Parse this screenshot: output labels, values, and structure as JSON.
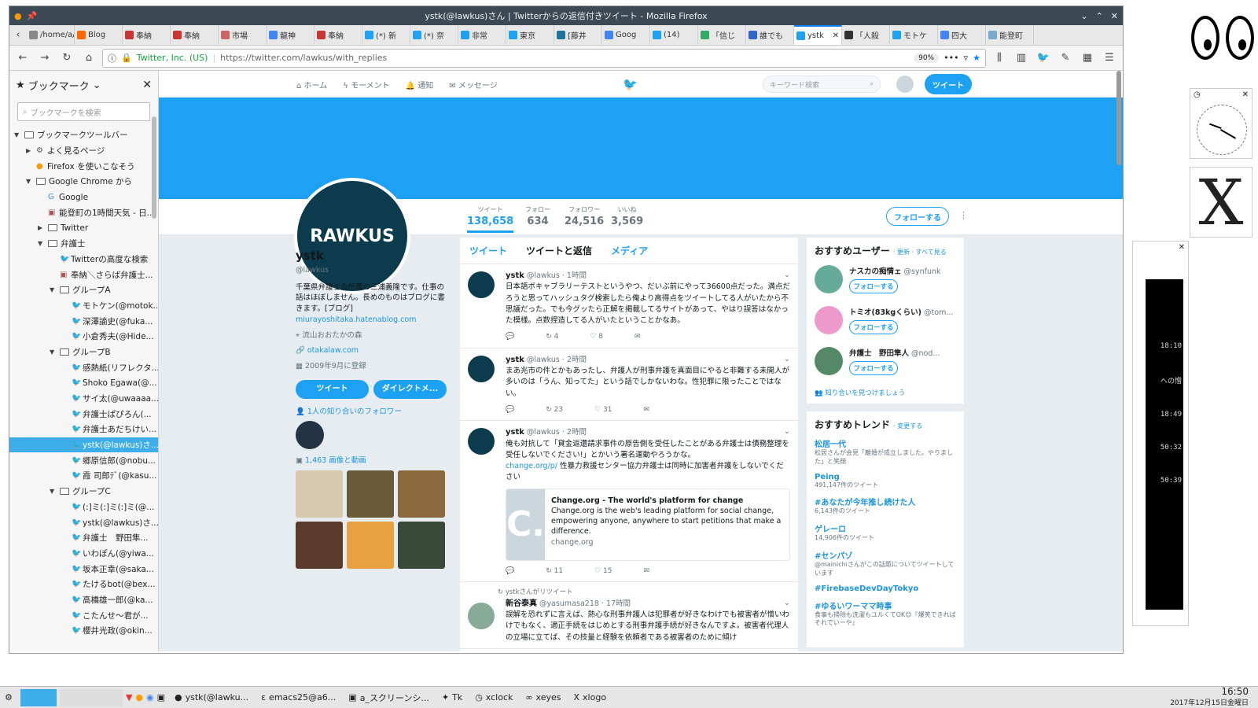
{
  "window": {
    "title": "ystk(@lawkus)さん | Twitterからの返信付きツイート - Mozilla Firefox"
  },
  "tabs": [
    {
      "label": "/home/a/",
      "color": "#888"
    },
    {
      "label": "Blog",
      "color": "#f60"
    },
    {
      "label": "奉納",
      "color": "#c33"
    },
    {
      "label": "奉納",
      "color": "#c33"
    },
    {
      "label": "市場",
      "color": "#c66"
    },
    {
      "label": "龍神",
      "color": "#4285f4"
    },
    {
      "label": "奉納",
      "color": "#c33"
    },
    {
      "label": "(*) 新",
      "color": "#1da1f2"
    },
    {
      "label": "(*) 奈",
      "color": "#1da1f2"
    },
    {
      "label": "非常",
      "color": "#1da1f2"
    },
    {
      "label": "東京",
      "color": "#1da1f2"
    },
    {
      "label": "[藤井",
      "color": "#21759b"
    },
    {
      "label": "Goog",
      "color": "#4285f4"
    },
    {
      "label": "(14) ",
      "color": "#1da1f2"
    },
    {
      "label": "「信じ",
      "color": "#3a6"
    },
    {
      "label": "誰でも",
      "color": "#36c"
    },
    {
      "label": "ystk",
      "color": "#1da1f2",
      "active": true
    },
    {
      "label": "「人殺",
      "color": "#333"
    },
    {
      "label": "モトケ",
      "color": "#1da1f2"
    },
    {
      "label": "四大",
      "color": "#4285f4"
    },
    {
      "label": "能登町",
      "color": "#7ac"
    }
  ],
  "nav": {
    "identity": "Twitter, Inc. (US)",
    "url": "https://twitter.com/lawkus/with_replies",
    "zoom": "90%"
  },
  "sidebar": {
    "title": "ブックマーク",
    "search_placeholder": "ブックマークを検索",
    "items": [
      {
        "label": "ブックマークツールバー",
        "indent": 0,
        "type": "folder",
        "arrow": "▼"
      },
      {
        "label": "よく見るページ",
        "indent": 1,
        "type": "gear",
        "arrow": "▶"
      },
      {
        "label": "Firefox を使いこなそう",
        "indent": 1,
        "type": "ff",
        "arrow": ""
      },
      {
        "label": "Google Chrome から",
        "indent": 1,
        "type": "folder",
        "arrow": "▼"
      },
      {
        "label": "Google",
        "indent": 2,
        "type": "g",
        "arrow": ""
      },
      {
        "label": "能登町の1時間天気 - 日...",
        "indent": 2,
        "type": "web",
        "arrow": ""
      },
      {
        "label": "Twitter",
        "indent": 2,
        "type": "folder",
        "arrow": "▶"
      },
      {
        "label": "弁護士",
        "indent": 2,
        "type": "folder",
        "arrow": "▼"
      },
      {
        "label": "Twitterの高度な検索",
        "indent": 3,
        "type": "tw",
        "arrow": ""
      },
      {
        "label": "奉納＼さらば弁護士...",
        "indent": 3,
        "type": "web",
        "arrow": ""
      },
      {
        "label": "グループA",
        "indent": 3,
        "type": "folder",
        "arrow": "▼"
      },
      {
        "label": "モトケン(@motok...",
        "indent": 4,
        "type": "tw",
        "arrow": ""
      },
      {
        "label": "深澤諭史(@fuka...",
        "indent": 4,
        "type": "tw",
        "arrow": ""
      },
      {
        "label": "小倉秀夫(@Hide...",
        "indent": 4,
        "type": "tw",
        "arrow": ""
      },
      {
        "label": "グループB",
        "indent": 3,
        "type": "folder",
        "arrow": "▼"
      },
      {
        "label": "感熱紙(リフレクタ...",
        "indent": 4,
        "type": "tw",
        "arrow": ""
      },
      {
        "label": "Shoko Egawa(@...",
        "indent": 4,
        "type": "tw",
        "arrow": ""
      },
      {
        "label": "サイ太(@uwaaaa...",
        "indent": 4,
        "type": "tw",
        "arrow": ""
      },
      {
        "label": "弁護士ぱぴろん(...",
        "indent": 4,
        "type": "tw",
        "arrow": ""
      },
      {
        "label": "弁護士あだちけい...",
        "indent": 4,
        "type": "tw",
        "arrow": ""
      },
      {
        "label": "ystk(@lawkus)さ...",
        "indent": 4,
        "type": "tw",
        "arrow": "",
        "selected": true
      },
      {
        "label": "郷原信郎(@nobu...",
        "indent": 4,
        "type": "tw",
        "arrow": ""
      },
      {
        "label": "霞 司郎ﾃﾞ(@kasu...",
        "indent": 4,
        "type": "tw",
        "arrow": ""
      },
      {
        "label": "グループC",
        "indent": 3,
        "type": "folder",
        "arrow": "▼"
      },
      {
        "label": "(:]ミ(:]ミ(:]ミ(@...",
        "indent": 4,
        "type": "tw",
        "arrow": ""
      },
      {
        "label": "ystk(@lawkus)さ...",
        "indent": 4,
        "type": "tw",
        "arrow": ""
      },
      {
        "label": "弁護士　野田隼...",
        "indent": 4,
        "type": "tw",
        "arrow": ""
      },
      {
        "label": "いわぽん(@yiwa...",
        "indent": 4,
        "type": "tw",
        "arrow": ""
      },
      {
        "label": "坂本正幸(@saka...",
        "indent": 4,
        "type": "tw",
        "arrow": ""
      },
      {
        "label": "たけるbot(@bex...",
        "indent": 4,
        "type": "tw",
        "arrow": ""
      },
      {
        "label": "高橋雄一郎(@ka...",
        "indent": 4,
        "type": "tw",
        "arrow": ""
      },
      {
        "label": "こたんせ～君が...",
        "indent": 4,
        "type": "tw",
        "arrow": ""
      },
      {
        "label": "櫻井光政(@okin...",
        "indent": 4,
        "type": "tw",
        "arrow": ""
      }
    ]
  },
  "twitter": {
    "nav": {
      "home": "ホーム",
      "moments": "モーメント",
      "notify": "通知",
      "messages": "メッセージ",
      "search_placeholder": "キーワード検索",
      "tweet": "ツイート"
    },
    "stats": [
      {
        "label": "ツイート",
        "value": "138,658",
        "active": true
      },
      {
        "label": "フォロー",
        "value": "634"
      },
      {
        "label": "フォロワー",
        "value": "24,516"
      },
      {
        "label": "いいね",
        "value": "3,569"
      }
    ],
    "follow": "フォローする",
    "avatar_text": "RAWKUS",
    "profile": {
      "name": "ystk",
      "handle": "@lawkus",
      "bio": "千葉県弁護士会所属の三浦義隆です。仕事の話はほぼしません。長めのものはブログに書きます。[ブログ]",
      "blog": "miurayoshitaka.hatenablog.com",
      "location": "流山おおたかの森",
      "site": "otakalaw.com",
      "joined": "2009年9月に登録",
      "btn_tweet": "ツイート",
      "btn_dm": "ダイレクトメ...",
      "followers_known": "1人の知り合いのフォロワー",
      "media": "1,463 画像と動画"
    },
    "thumbs": [
      "#d9c8b0",
      "#6b5a3a",
      "#8a6a3a",
      "#5a3a2a",
      "#e8a040",
      "#3a4a3a"
    ],
    "timeline_tabs": {
      "t1": "ツイート",
      "t2": "ツイートと返信",
      "t3": "メディア"
    },
    "tweets": [
      {
        "name": "ystk",
        "handle": "@lawkus · 1時間",
        "text": "日本語ボキャブラリーテストというやつ、だいぶ前にやって36600点だった。満点だろうと思ってハッシュタグ検索したら俺より高得点をツイートしてる人がいたから不思議だった。でも今グッたら正解を掲載してるサイトがあって、やはり誤答はなかった模様。点数捏造してる人がいたということかなあ。",
        "rt": "4",
        "like": "8",
        "link": ""
      },
      {
        "name": "ystk",
        "handle": "@lawkus · 2時間",
        "text": "まあ兆市の件とかもあったし、弁護人が刑事弁護を真面目にやると非難する未開人が多いのは「うん、知ってた」という話でしかないわな。性犯罪に限ったことではない。",
        "rt": "23",
        "like": "31",
        "link": ""
      },
      {
        "name": "ystk",
        "handle": "@lawkus · 2時間",
        "text": "俺も対抗して「貸金返還請求事件の原告側を受任したことがある弁護士は債務整理を受任しないでください!」とかいう署名運動やろうかな。",
        "link": "change.org/p/",
        "text2": "性暴力救援センター協力弁護士は同時に加害者弁護をしないでください",
        "rt": "11",
        "like": "15",
        "card": {
          "img": "C.",
          "title": "Change.org - The world's platform for change",
          "desc": "Change.org is the web's leading platform for social change, empowering anyone, anywhere to start petitions that make a difference.",
          "domain": "change.org"
        }
      },
      {
        "rt_by": "ystkさんがリツイート",
        "name": "新谷泰真",
        "handle": "@yasumasa218 · 17時間",
        "text": "誤解を恐れずに言えば、熱心な刑事弁護人は犯罪者が好きなわけでも被害者が憎いわけでもなく、適正手続をはじめとする刑事弁護手続が好きなんですよ。被害者代理人の立場に立てば、その技量と経験を依頼者である被害者のために傾け"
      }
    ],
    "who": {
      "title": "おすすめユーザー",
      "links": "· 更新 · すべて見る",
      "users": [
        {
          "name": "ナスカの痴情ェ",
          "handle": "@synfunk",
          "color": "#6a9"
        },
        {
          "name": "トミオ(83kgくらい)",
          "handle": "@tom...",
          "color": "#e9c"
        },
        {
          "name": "弁護士　野田隼人",
          "handle": "@nod...",
          "color": "#586"
        }
      ],
      "find": "知り合いを見つけましょう",
      "follow": "フォローする"
    },
    "trends": {
      "title": "おすすめトレンド",
      "change": "· 変更する",
      "items": [
        {
          "name": "松居一代",
          "desc": "松居さんが会見「離婚が成立しました。やりました」と笑顔"
        },
        {
          "name": "Peing",
          "desc": "491,147件のツイート"
        },
        {
          "name": "#あなたが今年推し続けた人",
          "desc": "6,143件のツイート"
        },
        {
          "name": "ゲレーロ",
          "desc": "14,906件のツイート"
        },
        {
          "name": "#センパゾ",
          "desc": "@mainichiさんがこの話題についてツイートしています"
        },
        {
          "name": "#FirebaseDevDayTokyo",
          "desc": ""
        },
        {
          "name": "#ゆるいワーママ時事",
          "desc": "食事も掃除も洗濯もユルくてOK😊『爆笑できればそれでいーや』"
        }
      ]
    }
  },
  "taskbar": {
    "items": [
      "ystk(@lawku...",
      "emacs25@a6...",
      "a_スクリーンシ...",
      "Tk",
      "xclock",
      "xeyes",
      "xlogo"
    ],
    "time": "16:50",
    "date": "2017年12月15日金曜日"
  },
  "terminal": {
    "lines": [
      "18:10",
      "への憎",
      "18:49",
      "50:32",
      "50:39"
    ]
  }
}
